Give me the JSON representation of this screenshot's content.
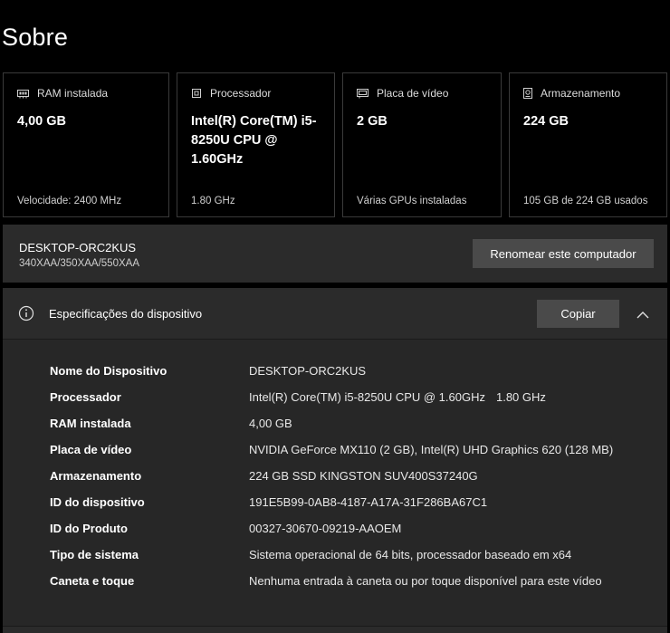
{
  "page": {
    "title": "Sobre"
  },
  "cards": [
    {
      "icon": "ram-icon",
      "label": "RAM instalada",
      "value": "4,00 GB",
      "footer": "Velocidade: 2400 MHz"
    },
    {
      "icon": "processor-icon",
      "label": "Processador",
      "value": "Intel(R) Core(TM) i5-8250U CPU @ 1.60GHz",
      "footer": "1.80 GHz"
    },
    {
      "icon": "gpu-icon",
      "label": "Placa de vídeo",
      "value": "2 GB",
      "footer": "Várias GPUs instaladas"
    },
    {
      "icon": "storage-icon",
      "label": "Armazenamento",
      "value": "224 GB",
      "footer": "105 GB de 224 GB usados"
    }
  ],
  "device": {
    "name": "DESKTOP-ORC2KUS",
    "model": "340XAA/350XAA/550XAA",
    "rename_label": "Renomear este computador"
  },
  "specs": {
    "title": "Especificações do dispositivo",
    "copy_label": "Copiar",
    "rows": [
      {
        "label": "Nome do Dispositivo",
        "value": "DESKTOP-ORC2KUS"
      },
      {
        "label": "Processador",
        "value": "Intel(R) Core(TM) i5-8250U CPU @ 1.60GHz",
        "extra": "1.80 GHz"
      },
      {
        "label": "RAM instalada",
        "value": "4,00 GB"
      },
      {
        "label": "Placa de vídeo",
        "value": "NVIDIA GeForce MX110 (2 GB), Intel(R) UHD Graphics 620 (128 MB)"
      },
      {
        "label": "Armazenamento",
        "value": "224 GB SSD KINGSTON SUV400S37240G"
      },
      {
        "label": "ID do dispositivo",
        "value": "191E5B99-0AB8-4187-A17A-31F286BA67C1"
      },
      {
        "label": "ID do Produto",
        "value": "00327-30670-09219-AAOEM"
      },
      {
        "label": "Tipo de sistema",
        "value": "Sistema operacional de 64 bits, processador baseado em x64"
      },
      {
        "label": "Caneta e toque",
        "value": "Nenhuma entrada à caneta ou por toque disponível para este vídeo"
      }
    ]
  }
}
